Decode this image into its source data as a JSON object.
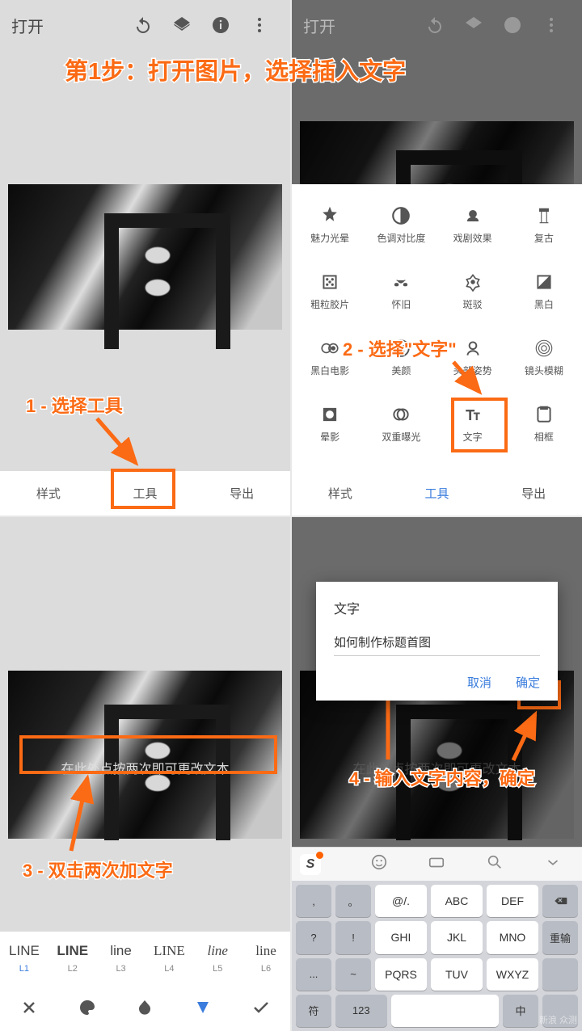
{
  "header": {
    "open_label": "打开"
  },
  "bottom_tabs": {
    "style": "样式",
    "tools": "工具",
    "export": "导出"
  },
  "tools_grid": [
    {
      "id": "glamour",
      "label": "魅力光晕"
    },
    {
      "id": "tonal",
      "label": "色调对比度"
    },
    {
      "id": "drama",
      "label": "戏剧效果"
    },
    {
      "id": "vintage",
      "label": "复古"
    },
    {
      "id": "grainy",
      "label": "粗粒胶片"
    },
    {
      "id": "retrolux",
      "label": "怀旧"
    },
    {
      "id": "grunge",
      "label": "斑驳"
    },
    {
      "id": "bw",
      "label": "黑白"
    },
    {
      "id": "noir",
      "label": "黑白电影"
    },
    {
      "id": "portrait",
      "label": "美颜"
    },
    {
      "id": "headpose",
      "label": "头部姿势"
    },
    {
      "id": "lensblur",
      "label": "镜头模糊"
    },
    {
      "id": "vignette",
      "label": "晕影"
    },
    {
      "id": "dblexp",
      "label": "双重曝光"
    },
    {
      "id": "text",
      "label": "文字"
    },
    {
      "id": "frames",
      "label": "相框"
    }
  ],
  "text_overlay_hint": "在此处点按两次即可更改文本",
  "styles_row": [
    {
      "id": "L1",
      "preview": "LINE"
    },
    {
      "id": "L2",
      "preview": "LINE"
    },
    {
      "id": "L3",
      "preview": "line"
    },
    {
      "id": "L4",
      "preview": "LINE"
    },
    {
      "id": "L5",
      "preview": "line"
    },
    {
      "id": "L6",
      "preview": "line"
    }
  ],
  "dialog": {
    "title": "文字",
    "input_value": "如何制作标题首图",
    "cancel": "取消",
    "confirm": "确定"
  },
  "keyboard": {
    "row1": [
      ",",
      "。",
      "@/.",
      "ABC",
      "DEF"
    ],
    "row2": [
      "?",
      "!",
      "GHI",
      "JKL",
      "MNO"
    ],
    "row3": [
      "...",
      "~",
      "PQRS",
      "TUV",
      "WXYZ"
    ],
    "row4_fn": [
      "符",
      "123",
      "中"
    ],
    "reinput": "重输"
  },
  "annotations": {
    "main_title": "第1步：打开图片，选择插入文字",
    "step1": "1 - 选择工具",
    "step2": "2 - 选择\"文字\"",
    "step3": "3 - 双击两次加文字",
    "step4": "4 - 输入文字内容，确定"
  },
  "watermark": "新浪\n众测"
}
